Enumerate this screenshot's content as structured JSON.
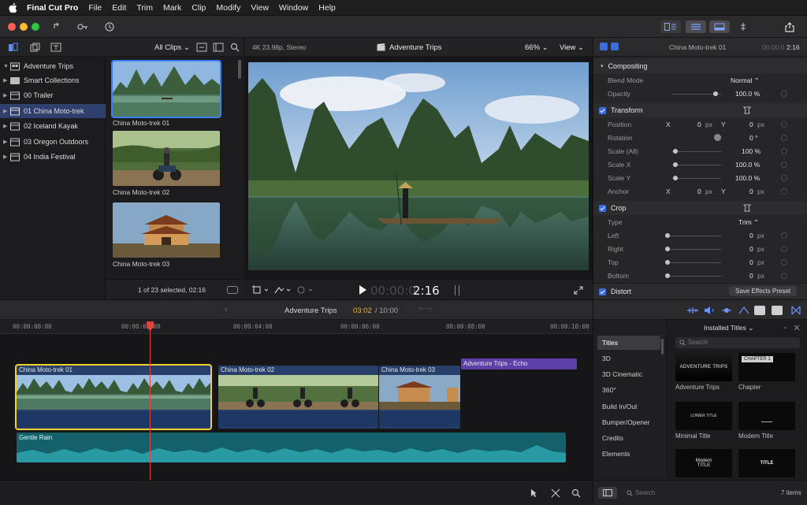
{
  "menubar": {
    "app_name": "Final Cut Pro",
    "menus": [
      "File",
      "Edit",
      "Trim",
      "Mark",
      "Clip",
      "Modify",
      "View",
      "Window",
      "Help"
    ]
  },
  "colors": {
    "accent": "#3d6ddc",
    "playhead": "#e0443e",
    "selection": "#f5cf2e",
    "title_clip": "#5c3fa8",
    "audio_clip": "#1b6f7a"
  },
  "browser": {
    "filter_label": "All Clips ⌄",
    "libraries": [
      {
        "label": "Adventure Trips",
        "kind": "library"
      },
      {
        "label": "Smart Collections",
        "kind": "folder"
      },
      {
        "label": "00 Trailer",
        "kind": "event"
      },
      {
        "label": "01 China Moto-trek",
        "kind": "event",
        "selected": true
      },
      {
        "label": "02 Iceland Kayak",
        "kind": "event"
      },
      {
        "label": "03 Oregon Outdoors",
        "kind": "event"
      },
      {
        "label": "04 India Festival",
        "kind": "event"
      }
    ],
    "clips": [
      {
        "label": "China Moto-trek 01",
        "selected": true
      },
      {
        "label": "China Moto-trek 02"
      },
      {
        "label": "China Moto-trek 03"
      }
    ],
    "selection_status": "1 of 23 selected, 02:16"
  },
  "viewer": {
    "format": "4K 23.98p, Stereo",
    "title": "Adventure Trips",
    "zoom": "66% ⌄",
    "view_menu": "View ⌄",
    "timecode_dim": "00:00:0",
    "timecode_lit": "2:16"
  },
  "inspector": {
    "clip_name": "China Moto-trek 01",
    "duration_dim": "00:00:0",
    "duration_lit": "2:16",
    "compositing": {
      "title": "Compositing",
      "blend_mode_label": "Blend Mode",
      "blend_mode_value": "Normal ⌃",
      "opacity_label": "Opacity",
      "opacity_value": "100.0 %"
    },
    "transform": {
      "title": "Transform",
      "position_label": "Position",
      "position_x": "0",
      "position_y": "0",
      "rotation_label": "Rotation",
      "rotation_value": "0 °",
      "scale_all_label": "Scale (All)",
      "scale_all_value": "100 %",
      "scale_x_label": "Scale X",
      "scale_x_value": "100.0 %",
      "scale_y_label": "Scale Y",
      "scale_y_value": "100.0 %",
      "anchor_label": "Anchor",
      "anchor_x": "0",
      "anchor_y": "0"
    },
    "crop": {
      "title": "Crop",
      "type_label": "Type",
      "type_value": "Trim ⌃",
      "left_label": "Left",
      "left_value": "0",
      "right_label": "Right",
      "right_value": "0",
      "top_label": "Top",
      "top_value": "0",
      "bottom_label": "Bottom",
      "bottom_value": "0"
    },
    "distort_title": "Distort",
    "save_preset": "Save Effects Preset",
    "axis_x": "X",
    "axis_y": "Y",
    "unit_px": "px"
  },
  "timeline": {
    "project": "Adventure Trips",
    "position": "03:02",
    "duration": "/ 10:00",
    "ruler": [
      "00:00:00:00",
      "00:00:02:00",
      "00:00:04:00",
      "00:00:06:00",
      "00:00:08:00",
      "00:00:10:00"
    ],
    "clips": [
      {
        "label": "China Moto-trek 01"
      },
      {
        "label": "China Moto-trek 02"
      },
      {
        "label": "China Moto-trek 03"
      }
    ],
    "title_clip": "Adventure Trips - Echo",
    "audio_clip": "Gentle Rain"
  },
  "effects": {
    "installed_titles": "Installed Titles ⌄",
    "search_placeholder": "Search",
    "categories": [
      "Titles",
      "3D",
      "3D Cinematic",
      "360°",
      "Build In/Out",
      "Bumper/Opener",
      "Credits",
      "Elements"
    ],
    "tiles": [
      {
        "label": "Adventure Trips",
        "art": "ADVENTURE TRIPS"
      },
      {
        "label": "Chapter",
        "art": "CHAPTER 1"
      },
      {
        "label": "Minimal Title",
        "art": "LOWER TITLE"
      },
      {
        "label": "Modern Title",
        "art": ""
      },
      {
        "label": "",
        "art": "Modern TITLE"
      },
      {
        "label": "",
        "art": "TITLE"
      }
    ],
    "footer_search": "Search",
    "item_count": "7 items"
  }
}
